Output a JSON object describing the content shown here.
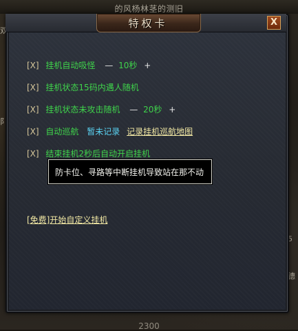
{
  "background": {
    "top_text": "的风杨林茎的测旧",
    "bottom_text": "2300",
    "left_frag_1": "双",
    "left_frag_2": "阝",
    "right_frag_1": "5",
    "right_frag_2": "德"
  },
  "dialog": {
    "title": "特权卡",
    "close_label": "X"
  },
  "options": [
    {
      "checkbox": "[X]",
      "label": "挂机自动吸怪",
      "minus": "—",
      "value": "10秒",
      "plus": "+"
    },
    {
      "checkbox": "[X]",
      "label": "挂机状态15码内遇人随机"
    },
    {
      "checkbox": "[X]",
      "label": "挂机状态未攻击随机",
      "minus": "—",
      "value": "20秒",
      "plus": "+"
    },
    {
      "checkbox": "[X]",
      "label": "自动巡航",
      "status": "暂未记录",
      "link": "记录挂机巡航地图"
    },
    {
      "checkbox": "[X]",
      "label": "结束挂机2秒后自动开启挂机"
    }
  ],
  "tooltip": "防卡位、寻路等中断挂机导致站在那不动",
  "free_start": "[免费]开始自定义挂机",
  "colors": {
    "option_text": "#3fd34b",
    "status_text": "#5ad2f2",
    "link_text": "#f2e8a4",
    "checkbox": "#d6c79a"
  }
}
